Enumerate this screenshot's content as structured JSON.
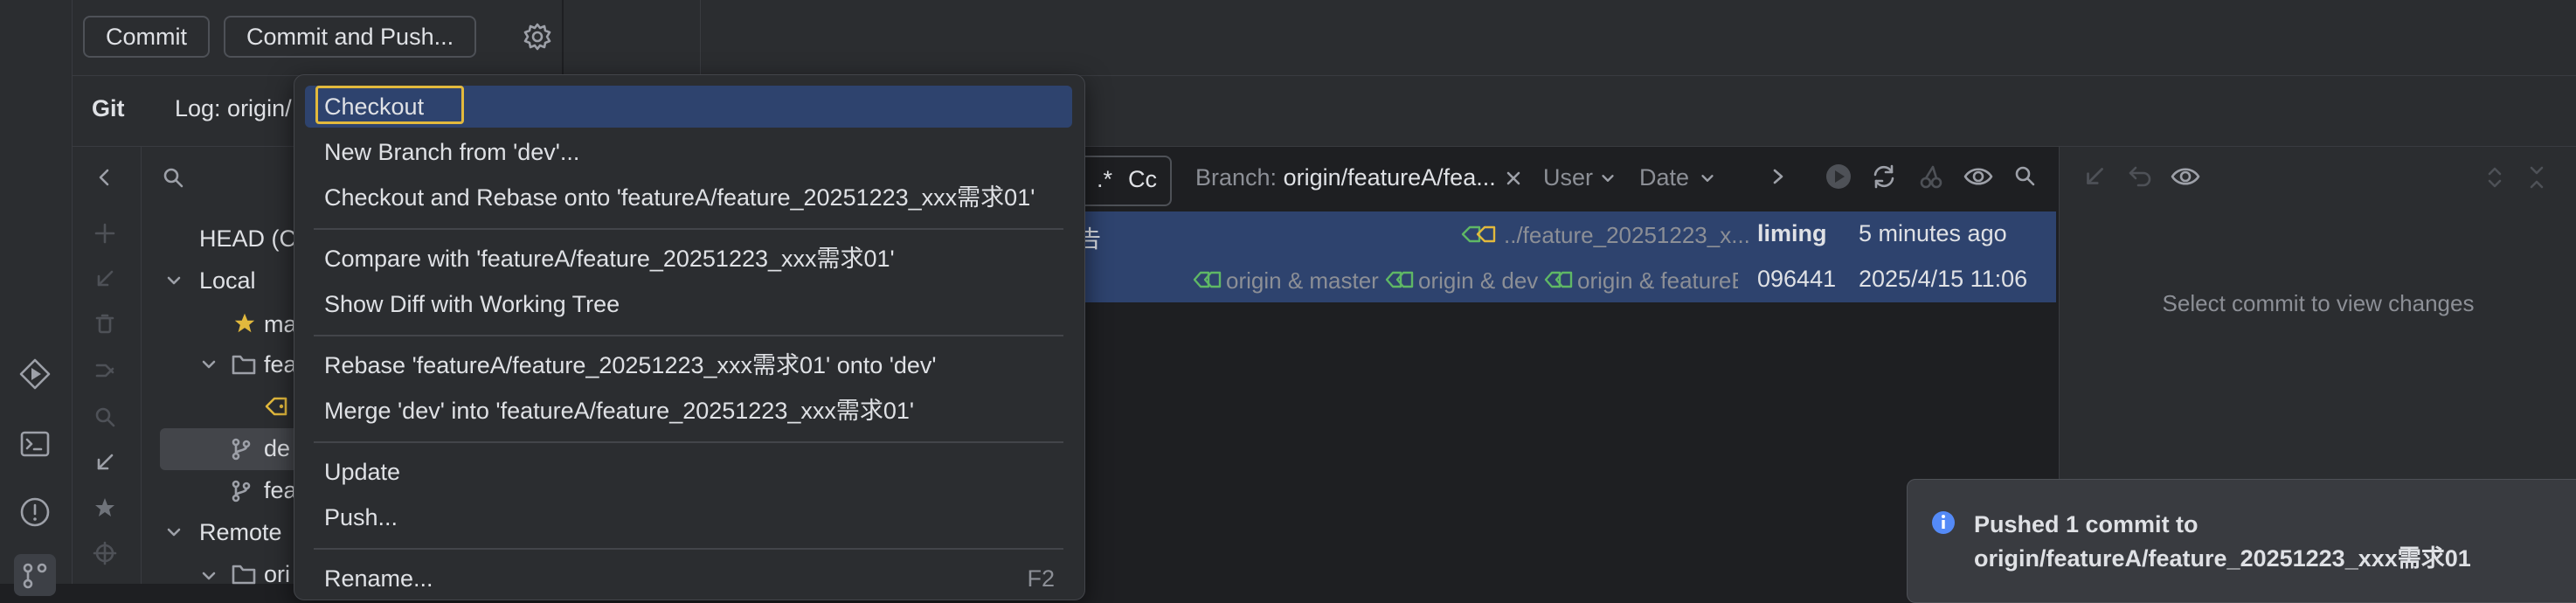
{
  "toolbar": {
    "commit_label": "Commit",
    "commit_push_label": "Commit and Push..."
  },
  "tabs": {
    "git_label": "Git",
    "log_label": "Log: origin/"
  },
  "branches": {
    "head_label": "HEAD (C",
    "local_label": "Local",
    "master_label": "ma",
    "feature_folder_label": "fea",
    "dev_label": "de",
    "feature_branch_label": "fea",
    "remote_label": "Remote",
    "origin_folder_label": "ori"
  },
  "log_filters": {
    "regex_label": ".*",
    "case_label": "Cc",
    "branch_prefix": "Branch:",
    "branch_value": "origin/featureA/fea...",
    "user_label": "User",
    "date_label": "Date"
  },
  "log": {
    "rows": [
      {
        "subject": "告",
        "refs": "../feature_20251223_x...",
        "author": "liming",
        "date": "5 minutes ago"
      },
      {
        "subject": "",
        "ref1": "origin & master",
        "ref2": "origin & dev",
        "ref3": "origin & featureB",
        "author": "096441",
        "date": "2025/4/15 11:06"
      }
    ]
  },
  "details": {
    "empty_text": "Select commit to view changes"
  },
  "context_menu": {
    "checkout": "Checkout",
    "new_branch": "New Branch from 'dev'...",
    "checkout_rebase": "Checkout and Rebase onto 'featureA/feature_20251223_xxx需求01'",
    "compare": "Compare with 'featureA/feature_20251223_xxx需求01'",
    "show_diff": "Show Diff with Working Tree",
    "rebase": "Rebase 'featureA/feature_20251223_xxx需求01' onto 'dev'",
    "merge": "Merge 'dev' into 'featureA/feature_20251223_xxx需求01'",
    "update": "Update",
    "push": "Push...",
    "rename": "Rename...",
    "rename_shortcut": "F2"
  },
  "notification": {
    "line1": "Pushed 1 commit to",
    "line2": "origin/featureA/feature_20251223_xxx需求01"
  },
  "colors": {
    "accent": "#2e436e",
    "focus_outline": "#e2b93d",
    "info_icon": "#548af7",
    "tag_gold": "#e2b93d",
    "tag_green": "#5fb865"
  },
  "icons": [
    "run-icon",
    "terminal-icon",
    "problems-icon",
    "git-icon",
    "gear-icon",
    "collapse-left-icon",
    "search-icon",
    "plus-icon",
    "fetch-icon",
    "trash-icon",
    "merge-icon",
    "star-icon",
    "folder-icon",
    "tag-icon",
    "branch-icon",
    "close-icon",
    "chevron-down-icon",
    "chevron-right-icon",
    "refresh-icon",
    "cherry-pick-icon",
    "eye-icon",
    "undo-icon",
    "info-icon"
  ]
}
